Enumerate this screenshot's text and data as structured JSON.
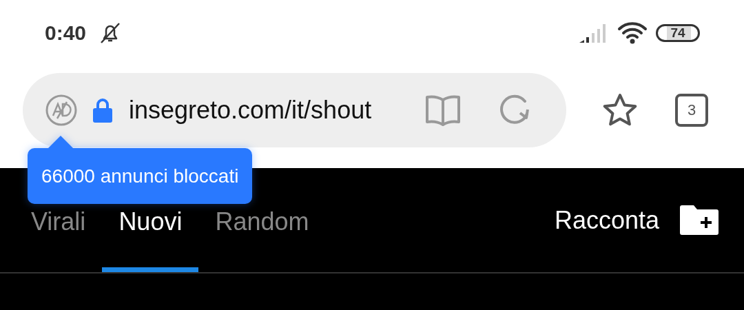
{
  "status_bar": {
    "time": "0:40",
    "battery": "74"
  },
  "address_bar": {
    "url": "insegreto.com/it/shout"
  },
  "tab_count": "3",
  "tooltip": {
    "text": "66000 annunci bloccati"
  },
  "nav": {
    "tabs": [
      {
        "label": "Virali",
        "selected": false
      },
      {
        "label": "Nuovi",
        "selected": true
      },
      {
        "label": "Random",
        "selected": false
      }
    ],
    "action": "Racconta"
  }
}
